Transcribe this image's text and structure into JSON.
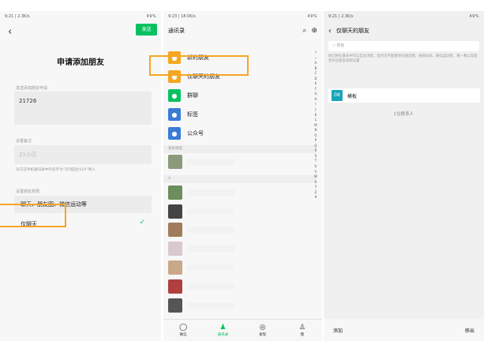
{
  "panel1": {
    "status_left": "9:21 | 2.3K/s",
    "status_right": "49%",
    "send_label": "发送",
    "title": "申请添加朋友",
    "request_caption": "发送添加朋友申请",
    "request_value": "21726",
    "remark_caption": "设置备注",
    "remark_value": "21小区",
    "hint_text": "对方在手机通讯录中的名字为“深沟园达510”填入",
    "permission_caption": "设置朋友权限",
    "option_all": "聊天、朋友圈、微信运动等",
    "option_chat_only": "仅聊天"
  },
  "panel2": {
    "status_left": "9:23 | 18.0K/s",
    "status_right": "49%",
    "title": "通讯录",
    "menu": [
      {
        "label": "新的朋友",
        "color": "#f5a623",
        "icon": "person-add-icon"
      },
      {
        "label": "仅聊天的朋友",
        "color": "#f5a623",
        "icon": "person-chat-icon"
      },
      {
        "label": "群聊",
        "color": "#07c160",
        "icon": "group-icon"
      },
      {
        "label": "标签",
        "color": "#3a7bd5",
        "icon": "tag-icon"
      },
      {
        "label": "公众号",
        "color": "#3a7bd5",
        "icon": "official-account-icon"
      }
    ],
    "section_starred": "星标朋友",
    "section_a": "A",
    "index_letters": "↑☆ABCDEFGHIJKLMNOPQRSTUVWXYZ#",
    "tabs": [
      {
        "label": "微信",
        "icon": "chat-bubble-icon",
        "glyph": "◯"
      },
      {
        "label": "通讯录",
        "icon": "contacts-icon",
        "glyph": "♟"
      },
      {
        "label": "发现",
        "icon": "compass-icon",
        "glyph": "◎"
      },
      {
        "label": "我",
        "icon": "me-icon",
        "glyph": "♙"
      }
    ],
    "avatar_colors": [
      "#8a9a7a",
      "#6b8e5a",
      "#444444",
      "#a07c5a",
      "#d8c8d0",
      "#c9a88a",
      "#b04040",
      "#555555"
    ]
  },
  "panel3": {
    "status_left": "9:21 | 2.3K/s",
    "status_right": "49%",
    "title": "仅聊天的朋友",
    "search_placeholder": "搜索",
    "note": "你们将在聊天中可以互发消息，但对方不能看你的朋友圈、视频动态、微信运动等，看一看以及是否开启朋友权限设置",
    "contact_badge": "08",
    "contact_name": "模板",
    "count_text": "1位联系人",
    "add_label": "添加",
    "remove_label": "移出"
  }
}
